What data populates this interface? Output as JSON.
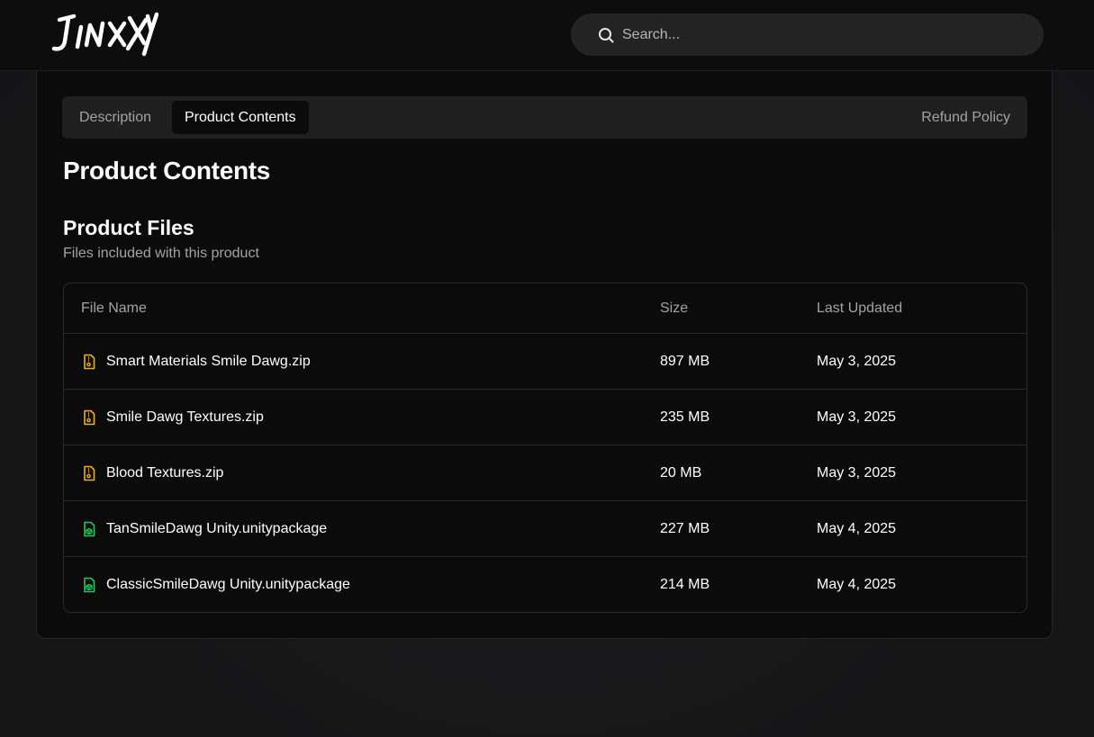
{
  "header": {
    "logo_text": "JINXXY",
    "search_placeholder": "Search..."
  },
  "tabs": {
    "description": "Description",
    "product_contents": "Product Contents",
    "refund_policy": "Refund Policy"
  },
  "page_title": "Product Contents",
  "section": {
    "title": "Product Files",
    "subtitle": "Files included with this product"
  },
  "table": {
    "headers": {
      "name": "File Name",
      "size": "Size",
      "updated": "Last Updated"
    },
    "rows": [
      {
        "name": "Smart Materials Smile Dawg.zip",
        "size": "897 MB",
        "updated": "May 3, 2025",
        "icon": "zip-file-icon"
      },
      {
        "name": "Smile Dawg Textures.zip",
        "size": "235 MB",
        "updated": "May 3, 2025",
        "icon": "zip-file-icon"
      },
      {
        "name": "Blood Textures.zip",
        "size": "20 MB",
        "updated": "May 3, 2025",
        "icon": "zip-file-icon"
      },
      {
        "name": "TanSmileDawg Unity.unitypackage",
        "size": "227 MB",
        "updated": "May 4, 2025",
        "icon": "package-file-icon"
      },
      {
        "name": "ClassicSmileDawg Unity.unitypackage",
        "size": "214 MB",
        "updated": "May 4, 2025",
        "icon": "package-file-icon"
      }
    ]
  },
  "colors": {
    "zip_icon": "#eab308",
    "package_icon": "#22c55e",
    "muted_text": "#a3a3a3"
  }
}
